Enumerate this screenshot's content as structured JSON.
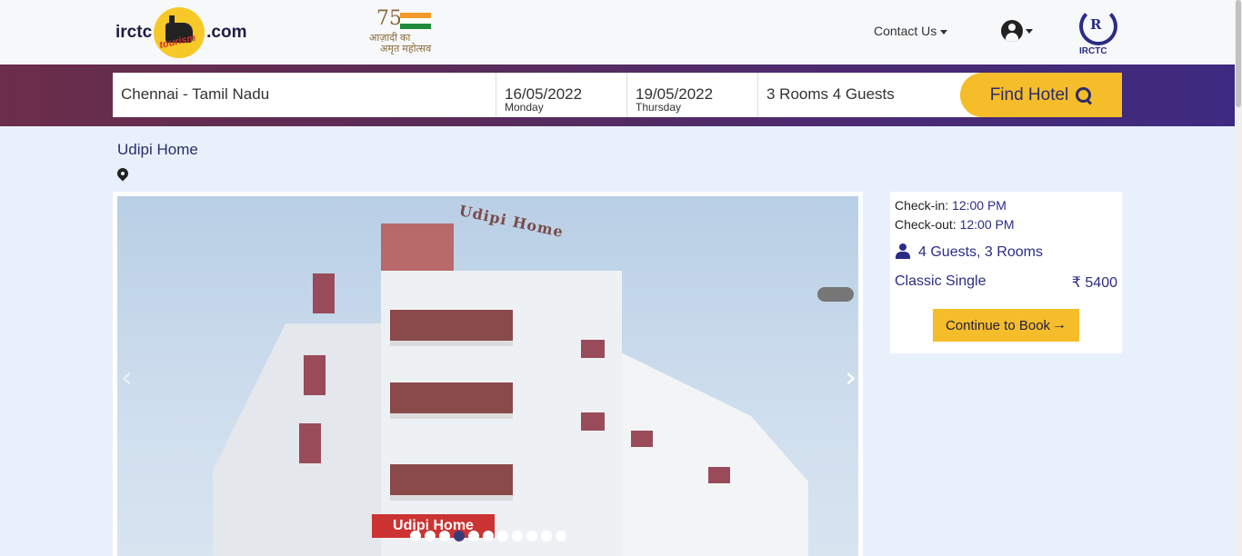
{
  "header": {
    "logo_left": "irctc",
    "logo_badge": "tourism",
    "logo_right": ".com",
    "azadi_num": "75",
    "azadi_line1": "आज़ादी का",
    "azadi_line2": "अमृत महोत्सव",
    "contact_label": "Contact Us",
    "irctc_letter": "R",
    "irctc_label": "IRCTC"
  },
  "search": {
    "destination": "Chennai - Tamil Nadu",
    "checkin_date": "16/05/2022",
    "checkin_day": "Monday",
    "checkout_date": "19/05/2022",
    "checkout_day": "Thursday",
    "rooms_guests": "3 Rooms 4 Guests",
    "find_label": "Find Hotel"
  },
  "hotel": {
    "name": "Udipi Home",
    "sign_text": "Udipi Home",
    "roof_sign": "Udipi Home",
    "slides": 11,
    "active_slide": 4,
    "prev_arrow": "‹",
    "next_arrow": "›"
  },
  "booking": {
    "checkin_label": "Check-in:",
    "checkin_time": "12:00 PM",
    "checkout_label": "Check-out:",
    "checkout_time": "12:00 PM",
    "guests_rooms": "4 Guests, 3 Rooms",
    "room_type": "Classic Single",
    "price": "₹ 5400",
    "continue_label": "Continue to Book",
    "continue_arrow": "→"
  },
  "colors": {
    "primary": "#2b2c86",
    "accent": "#f6bd2b",
    "band_start": "#6b2d49",
    "band_end": "#3d2a80",
    "page_bg": "#e8f1fb"
  }
}
